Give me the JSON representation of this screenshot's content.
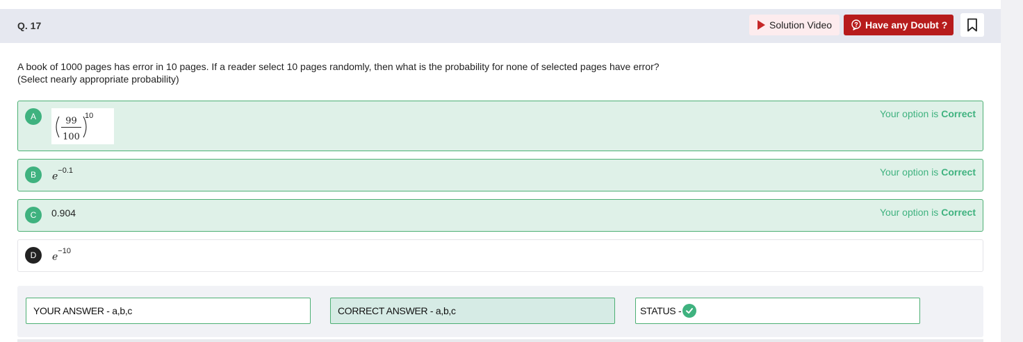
{
  "question": {
    "number": "Q. 17",
    "text_line1": "A book of 1000 pages has error in 10 pages. If a reader select 10 pages randomly, then what is the probability for none of selected pages have error?",
    "text_line2": "(Select nearly appropriate probability)"
  },
  "header": {
    "solution_video_label": "Solution Video",
    "doubt_label": "Have any Doubt ?",
    "icons": {
      "solution": "play-icon",
      "doubt": "question-bubble-icon",
      "bookmark": "bookmark-icon"
    },
    "colors": {
      "doubt_bg": "#b71c1c",
      "solution_bg": "#fdecee",
      "header_bg": "#e6e8f0"
    }
  },
  "options": [
    {
      "letter": "A",
      "numerator": "99",
      "denominator": "100",
      "exponent": "10",
      "status_prefix": "Your option is",
      "status_word": "Correct"
    },
    {
      "letter": "B",
      "base": "e",
      "exponent": "−0.1",
      "status_prefix": "Your option is",
      "status_word": "Correct"
    },
    {
      "letter": "C",
      "value": "0.904",
      "status_prefix": "Your option is",
      "status_word": "Correct"
    },
    {
      "letter": "D",
      "base": "e",
      "exponent": "−10"
    }
  ],
  "summary": {
    "your_answer": "YOUR ANSWER - a,b,c",
    "correct_answer": "CORRECT ANSWER - a,b,c",
    "status_label": "STATUS -"
  },
  "colors": {
    "correct_green": "#3fb27f",
    "correct_bg": "#dff1e8"
  }
}
